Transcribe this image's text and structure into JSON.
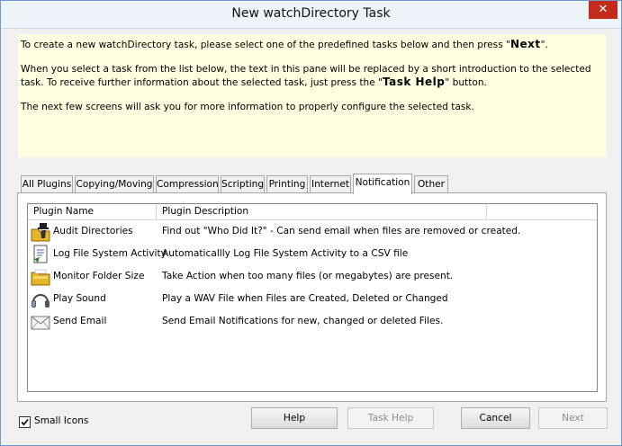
{
  "window": {
    "title": "New watchDirectory Task",
    "close_glyph": "✕"
  },
  "intro": {
    "line1_pre": "To create a new watchDirectory task, please select one of the predefined tasks below and then press \"",
    "line1_bold": "Next",
    "line1_post": "\".",
    "line2_pre": "When you select a task from the list below, the text in this pane will be replaced by a short introduction to the selected task. To receive further information about the selected task, just press the \"",
    "line2_bold": "Task Help",
    "line2_post": "\" button.",
    "line3": "The next few screens will ask you for more information to properly configure the selected task."
  },
  "tabs": [
    {
      "label": "All Plugins"
    },
    {
      "label": "Copying/Moving"
    },
    {
      "label": "Compression"
    },
    {
      "label": "Scripting"
    },
    {
      "label": "Printing"
    },
    {
      "label": "Internet"
    },
    {
      "label": "Notification"
    },
    {
      "label": "Other"
    }
  ],
  "active_tab": "Notification",
  "list": {
    "columns": [
      "Plugin Name",
      "Plugin Description"
    ],
    "rows": [
      {
        "name": "Audit Directories",
        "description": "Find out \"Who Did It?\" - Can send email when files are removed or created.",
        "icon": "folder-spy-icon"
      },
      {
        "name": "Log File System Activity",
        "description": "Automaticallly Log File System Activity to a CSV file",
        "icon": "log-file-icon"
      },
      {
        "name": "Monitor Folder Size",
        "description": "Take Action when too many files (or megabytes) are present.",
        "icon": "folder-size-icon"
      },
      {
        "name": "Play Sound",
        "description": "Play a WAV File when Files are Created, Deleted or Changed",
        "icon": "headphones-icon"
      },
      {
        "name": "Send Email",
        "description": "Send Email Notifications for new, changed or deleted Files.",
        "icon": "envelope-icon"
      }
    ]
  },
  "footer": {
    "small_icons_label": "Small Icons",
    "small_icons_checked": true,
    "help_label": "Help",
    "task_help_label": "Task Help",
    "cancel_label": "Cancel",
    "next_label": "Next"
  }
}
